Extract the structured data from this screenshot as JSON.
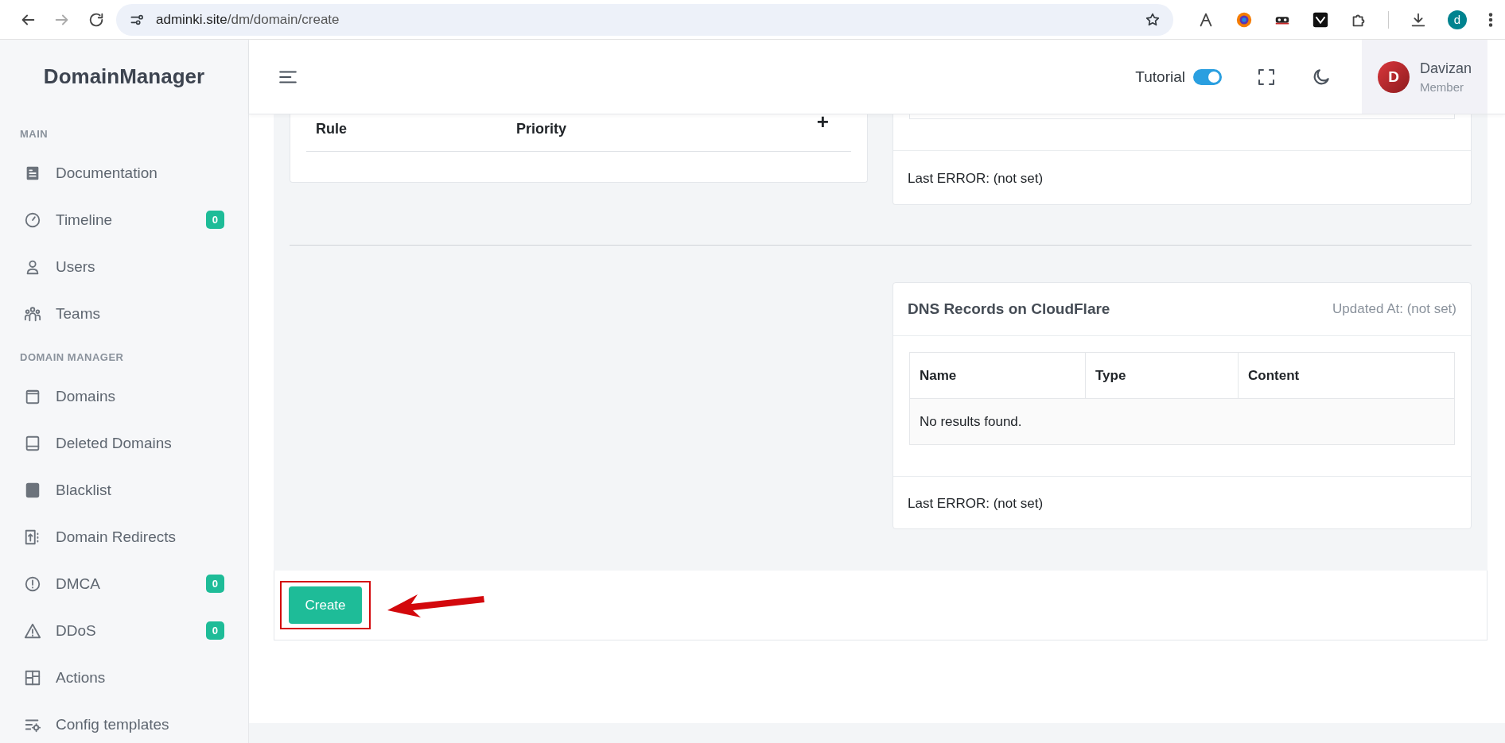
{
  "browser": {
    "url_host": "adminki.site",
    "url_path": "/dm/domain/create",
    "profile_initial": "d"
  },
  "sidebar": {
    "brand": "DomainManager",
    "sections": [
      {
        "title": "MAIN",
        "items": [
          {
            "label": "Documentation"
          },
          {
            "label": "Timeline",
            "badge": "0"
          },
          {
            "label": "Users"
          },
          {
            "label": "Teams"
          }
        ]
      },
      {
        "title": "DOMAIN MANAGER",
        "items": [
          {
            "label": "Domains"
          },
          {
            "label": "Deleted Domains"
          },
          {
            "label": "Blacklist"
          },
          {
            "label": "Domain Redirects"
          },
          {
            "label": "DMCA",
            "badge": "0"
          },
          {
            "label": "DDoS",
            "badge": "0"
          },
          {
            "label": "Actions"
          },
          {
            "label": "Config templates"
          }
        ]
      }
    ]
  },
  "header": {
    "tutorial_label": "Tutorial",
    "tutorial_on": true,
    "user": {
      "initial": "D",
      "name": "Davizan",
      "role": "Member"
    }
  },
  "rules_card": {
    "columns": [
      "Rule",
      "Priority"
    ],
    "add_symbol": "+"
  },
  "status_card": {
    "last_error": "Last ERROR: (not set)"
  },
  "dns_card": {
    "title": "DNS Records on CloudFlare",
    "updated": "Updated At: (not set)",
    "columns": [
      "Name",
      "Type",
      "Content"
    ],
    "empty_text": "No results found.",
    "last_error": "Last ERROR: (not set)"
  },
  "footer": {
    "button": "Create"
  }
}
